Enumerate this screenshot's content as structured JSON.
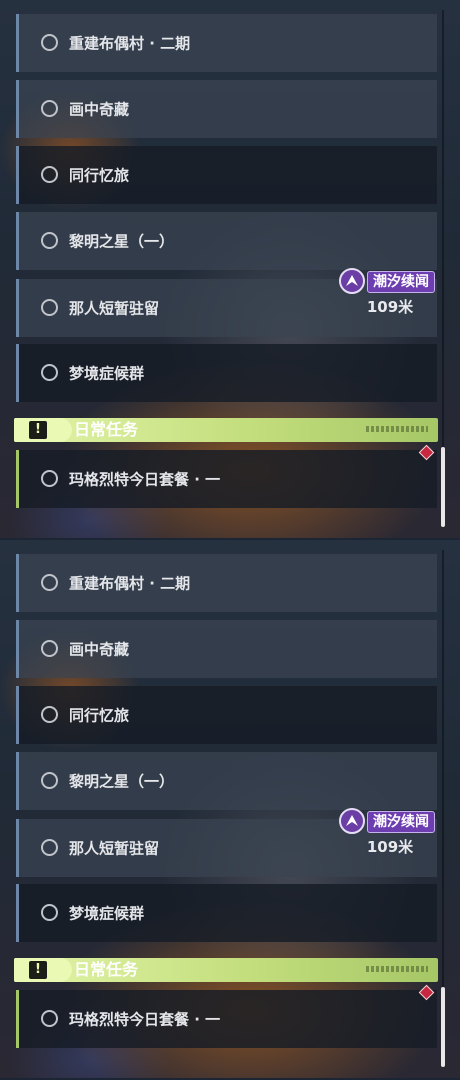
{
  "quests": [
    {
      "title": "重建布偶村 · 二期"
    },
    {
      "title": "画中奇藏"
    },
    {
      "title": "同行忆旅"
    },
    {
      "title": "黎明之星（一）"
    },
    {
      "title": "那人短暂驻留"
    },
    {
      "title": "梦境症候群"
    }
  ],
  "tracked_quest": {
    "badge_label": "潮汐续闻",
    "distance": "109米"
  },
  "daily_section": {
    "label": "日常任务",
    "icon": "exclamation-icon"
  },
  "daily_quests": [
    {
      "title": "玛格烈特今日套餐 · 一"
    }
  ],
  "colors": {
    "quest_accent": "#6d87a8",
    "daily_accent": "#c3de7d",
    "badge": "#6d3eb0",
    "alert": "#c8283f"
  },
  "panels": [
    {
      "name": "panel-top"
    },
    {
      "name": "panel-bottom"
    }
  ]
}
